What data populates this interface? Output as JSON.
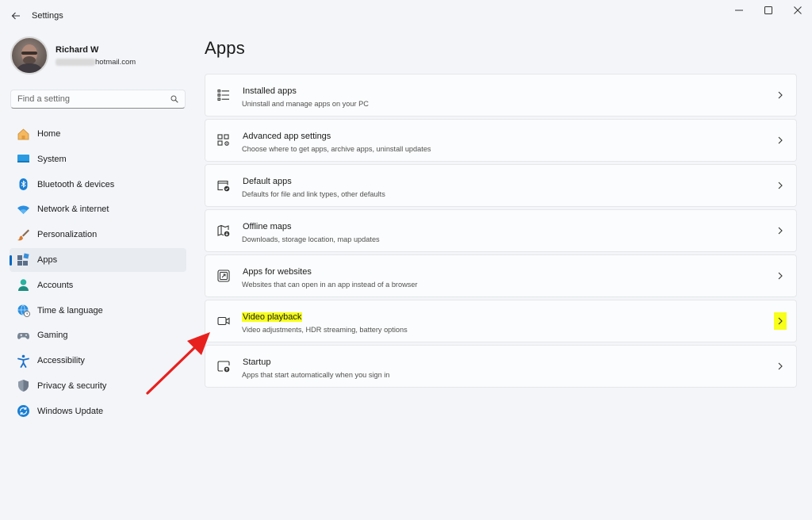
{
  "titlebar": {
    "app_title": "Settings"
  },
  "profile": {
    "name": "Richard W",
    "email_visible": "hotmail.com"
  },
  "search": {
    "placeholder": "Find a setting"
  },
  "sidebar": {
    "items": [
      {
        "label": "Home",
        "icon": "home-icon",
        "active": false
      },
      {
        "label": "System",
        "icon": "system-icon",
        "active": false
      },
      {
        "label": "Bluetooth & devices",
        "icon": "bluetooth-icon",
        "active": false
      },
      {
        "label": "Network & internet",
        "icon": "wifi-icon",
        "active": false
      },
      {
        "label": "Personalization",
        "icon": "brush-icon",
        "active": false
      },
      {
        "label": "Apps",
        "icon": "apps-icon",
        "active": true
      },
      {
        "label": "Accounts",
        "icon": "accounts-icon",
        "active": false
      },
      {
        "label": "Time & language",
        "icon": "globe-clock-icon",
        "active": false
      },
      {
        "label": "Gaming",
        "icon": "gamepad-icon",
        "active": false
      },
      {
        "label": "Accessibility",
        "icon": "accessibility-icon",
        "active": false
      },
      {
        "label": "Privacy & security",
        "icon": "shield-icon",
        "active": false
      },
      {
        "label": "Windows Update",
        "icon": "update-icon",
        "active": false
      }
    ]
  },
  "main": {
    "title": "Apps",
    "cards": [
      {
        "title": "Installed apps",
        "subtitle": "Uninstall and manage apps on your PC",
        "icon": "list-icon",
        "highlighted": false
      },
      {
        "title": "Advanced app settings",
        "subtitle": "Choose where to get apps, archive apps, uninstall updates",
        "icon": "app-settings-icon",
        "highlighted": false
      },
      {
        "title": "Default apps",
        "subtitle": "Defaults for file and link types, other defaults",
        "icon": "default-apps-icon",
        "highlighted": false
      },
      {
        "title": "Offline maps",
        "subtitle": "Downloads, storage location, map updates",
        "icon": "map-download-icon",
        "highlighted": false
      },
      {
        "title": "Apps for websites",
        "subtitle": "Websites that can open in an app instead of a browser",
        "icon": "link-app-icon",
        "highlighted": false
      },
      {
        "title": "Video playback",
        "subtitle": "Video adjustments, HDR streaming, battery options",
        "icon": "video-camera-icon",
        "highlighted": true
      },
      {
        "title": "Startup",
        "subtitle": "Apps that start automatically when you sign in",
        "icon": "startup-icon",
        "highlighted": false
      }
    ]
  },
  "colors": {
    "accent": "#0067c0",
    "highlight": "#f7ff1a",
    "annotation_arrow": "#e8201d"
  }
}
